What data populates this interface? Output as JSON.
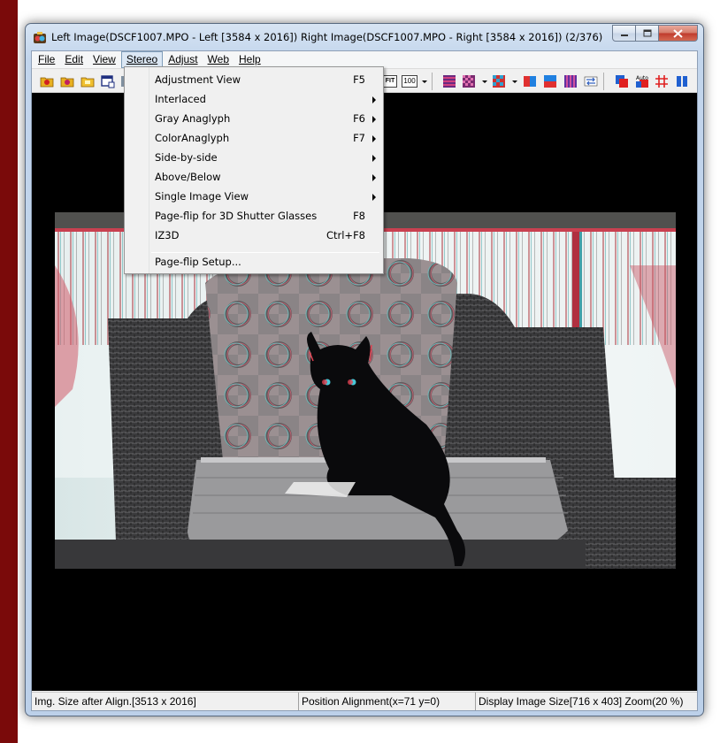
{
  "window": {
    "title": "Left Image(DSCF1007.MPO - Left [3584 x 2016]) Right Image(DSCF1007.MPO - Right [3584 x 2016])  (2/376)"
  },
  "menubar": [
    {
      "label": "File"
    },
    {
      "label": "Edit"
    },
    {
      "label": "View"
    },
    {
      "label": "Stereo"
    },
    {
      "label": "Adjust"
    },
    {
      "label": "Web"
    },
    {
      "label": "Help"
    }
  ],
  "toolbar": {
    "fit_label": "FIT",
    "zoom_label": "100"
  },
  "stereo_menu": [
    {
      "label": "Adjustment View",
      "shortcut": "F5"
    },
    {
      "label": "Interlaced",
      "shortcut": ""
    },
    {
      "label": "Gray Anaglyph",
      "shortcut": "F6"
    },
    {
      "label": "ColorAnaglyph",
      "shortcut": "F7"
    },
    {
      "label": "Side-by-side",
      "shortcut": ""
    },
    {
      "label": "Above/Below",
      "shortcut": ""
    },
    {
      "label": "Single Image View",
      "shortcut": ""
    },
    {
      "label": "Page-flip for 3D Shutter Glasses",
      "shortcut": "F8"
    },
    {
      "label": "IZ3D",
      "shortcut": "Ctrl+F8"
    },
    {
      "label": "Page-flip Setup...",
      "shortcut": ""
    }
  ],
  "statusbar": {
    "img_size": "Img. Size after Align.[3513 x 2016]",
    "position": "Position Alignment(x=71 y=0)",
    "display": "Display Image Size[716 x 403]  Zoom(20 %)"
  },
  "colors": {
    "accent": "#7f9db9",
    "strip": "#7a0a0a",
    "anaglyph_red": "#e03040",
    "anaglyph_cyan": "#40c8d0"
  }
}
